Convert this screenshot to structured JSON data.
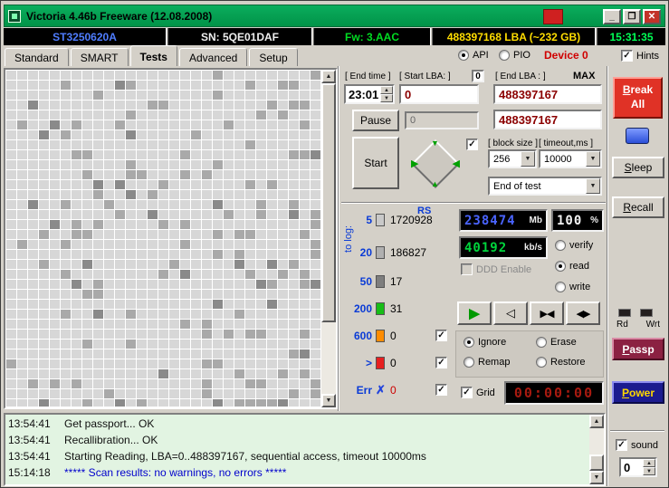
{
  "window": {
    "title": "Victoria 4.46b Freeware (12.08.2008)",
    "btn_min": "_",
    "btn_max": "❐",
    "btn_close": "✕"
  },
  "infobar": {
    "model": "ST3250620A",
    "serial": "SN: 5QE01DAF",
    "firmware": "Fw: 3.AAC",
    "capacity": "488397168 LBA (~232 GB)",
    "clock": "15:31:35"
  },
  "tabs": [
    {
      "label": "Standard"
    },
    {
      "label": "SMART"
    },
    {
      "label": "Tests"
    },
    {
      "label": "Advanced"
    },
    {
      "label": "Setup"
    }
  ],
  "mode": {
    "api_label": "API",
    "pio_label": "PIO",
    "device_label": "Device 0",
    "hints_label": "Hints"
  },
  "test": {
    "end_time_label": "[ End time ]",
    "end_time_value": "23:01",
    "start_lba_label": "[ Start LBA: ]",
    "start_lba_tag": "0",
    "end_lba_label": "[ End LBA : ]",
    "end_lba_tag": "MAX",
    "start_lba_value": "0",
    "end_lba_value": "488397167",
    "current_lba_value": "488397167",
    "pause_label": "Pause",
    "pause_field_value": "0",
    "start_label": "Start",
    "block_size_label": "[ block size ]",
    "block_size_value": "256",
    "timeout_label": "[ timeout,ms ]",
    "timeout_value": "10000",
    "end_action_value": "End of test",
    "rs_label": "RS",
    "to_log_label": "to log:",
    "counters": [
      {
        "label": "5",
        "value": "1720928"
      },
      {
        "label": "20",
        "value": "186827"
      },
      {
        "label": "50",
        "value": "17"
      },
      {
        "label": "200",
        "value": "31"
      },
      {
        "label": "600",
        "value": "0"
      },
      {
        "label": ">",
        "value": "0"
      },
      {
        "label": "Err",
        "value": "0"
      }
    ],
    "mb_value": "238474",
    "mb_unit": "Mb",
    "percent_value": "100",
    "percent_unit": "%",
    "speed_value": "40192",
    "speed_unit": "kb/s",
    "ddd_label": "DDD Enable",
    "verify_label": "verify",
    "read_label": "read",
    "write_label": "write",
    "ignore_label": "Ignore",
    "erase_label": "Erase",
    "remap_label": "Remap",
    "restore_label": "Restore",
    "grid_label": "Grid",
    "timer_value": "00:00:00"
  },
  "side": {
    "break_all_label": "Break All",
    "sleep_label": "Sleep",
    "recall_label": "Recall",
    "rd_label": "Rd",
    "wrt_label": "Wrt",
    "passp_label": "Passp",
    "power_label": "Power",
    "sound_label": "sound",
    "sound_value": "0"
  },
  "log": {
    "lines": [
      {
        "time": "13:54:41",
        "text": "Get passport... OK"
      },
      {
        "time": "13:54:41",
        "text": "Recallibration... OK"
      },
      {
        "time": "13:54:41",
        "text": "Starting Reading, LBA=0..488397167, sequential access, timeout 10000ms"
      },
      {
        "time": "15:14:18",
        "text": "***** Scan results: no warnings, no errors *****"
      }
    ]
  },
  "icons": {
    "spin_up": "▲",
    "spin_down": "▼",
    "dd_arrow": "▼",
    "scroll_up": "▲",
    "scroll_down": "▼",
    "play": "▶",
    "rewind": "◁",
    "seek_a": "▶◀",
    "seek_b": "◀▶",
    "jog_left": "▶",
    "jog_right": "◀",
    "jog_up": "▼",
    "jog_down": "▲"
  },
  "colors": {
    "titlebar_green": "#01a050",
    "counter_blocks": [
      "#c9c9c9",
      "#b0b0b0",
      "#7e7e7e",
      "#17bd17",
      "#ff8c00",
      "#e62020",
      "x"
    ],
    "err_x_color": "#2244dd",
    "lcd_blue": "#4a64ff",
    "lcd_green": "#00d53c",
    "timer_red": "#a81a10",
    "log_highlight": "#0000cc",
    "device_red": "#d00000"
  },
  "scan_grid": {
    "cols": 29,
    "rows": 34,
    "colors": {
      "light": "#d7d7d7",
      "mid": "#a9a9a9",
      "dark": "#8a8a8a"
    },
    "mid_ratio": 0.12,
    "dark_ratio": 0.03,
    "seed": 1337
  }
}
